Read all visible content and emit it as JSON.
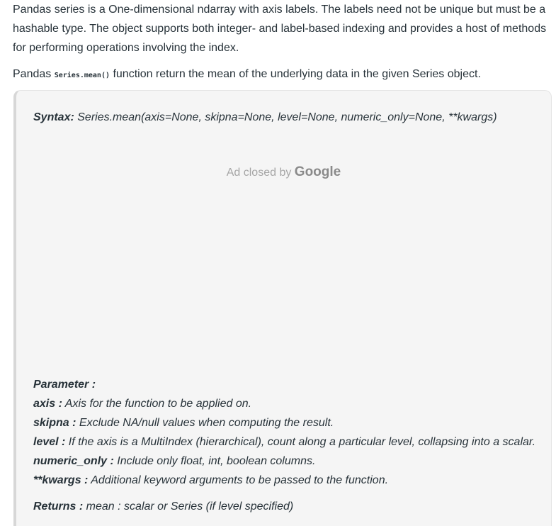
{
  "intro": {
    "text": "Pandas series is a One-dimensional ndarray with axis labels. The labels need not be unique but must be a hashable type. The object supports both integer- and label-based indexing and provides a host of methods for performing operations involving the index."
  },
  "mean_line": {
    "prefix": "Pandas ",
    "code": "Series.mean()",
    "suffix": " function return the mean of the underlying data in the given Series object."
  },
  "syntax": {
    "label": "Syntax:",
    "text": " Series.mean(axis=None, skipna=None, level=None, numeric_only=None, **kwargs)"
  },
  "ad": {
    "prefix": "Ad closed by ",
    "brand": "Google"
  },
  "parameters": {
    "heading": "Parameter :",
    "items": [
      {
        "name": "axis :",
        "desc": " Axis for the function to be applied on."
      },
      {
        "name": "skipna :",
        "desc": " Exclude NA/null values when computing the result."
      },
      {
        "name": "level :",
        "desc": " If the axis is a MultiIndex (hierarchical), count along a particular level, collapsing into a scalar."
      },
      {
        "name": "numeric_only :",
        "desc": " Include only float, int, boolean columns."
      },
      {
        "name": "**kwargs :",
        "desc": " Additional keyword arguments to be passed to the function."
      }
    ]
  },
  "returns": {
    "label": "Returns :",
    "text": " mean : scalar or Series (if level specified)"
  }
}
